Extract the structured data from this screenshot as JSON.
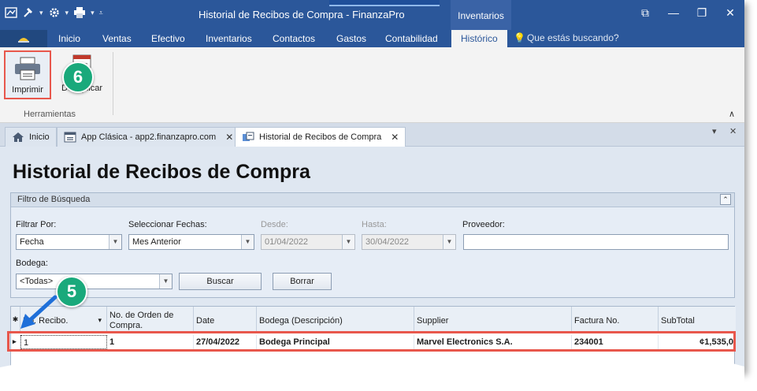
{
  "window": {
    "title": "Historial de Recibos de Compra - FinanzaPro",
    "context_tab": "Inventarios",
    "controls": {
      "restore": "⧉",
      "minimize": "—",
      "maximize": "❐",
      "close": "✕"
    }
  },
  "quick_access": {
    "icons": [
      "app-icon",
      "hammer-icon",
      "gear-icon",
      "printer-icon"
    ],
    "dropdown": "▾",
    "customize": "⩡"
  },
  "ribbon_tabs": {
    "file_icon": "app-menu-icon",
    "items": [
      "Inicio",
      "Ventas",
      "Efectivo",
      "Inventarios",
      "Contactos",
      "Gastos",
      "Contabilidad",
      "Histórico"
    ],
    "active": "Histórico",
    "search_placeholder": "Que estás buscando?"
  },
  "ribbon": {
    "print_label": "Imprimir",
    "unprint_label": "Desaplicar",
    "group_label": "Herramientas",
    "collapse": "∧"
  },
  "annotations": {
    "step_6": "6",
    "step_5": "5"
  },
  "doc_tabs": {
    "items": [
      {
        "label": "Inicio",
        "icon": "home-icon",
        "closable": false
      },
      {
        "label": "App Clásica - app2.finanzapro.com",
        "icon": "window-icon",
        "closable": true
      },
      {
        "label": "Historial de Recibos de Compra",
        "icon": "receipt-icon",
        "closable": true
      }
    ],
    "active_index": 2,
    "close_glyph": "✕",
    "menu_glyph": "▾"
  },
  "page": {
    "title": "Historial de Recibos de Compra"
  },
  "filter": {
    "title": "Filtro de Búsqueda",
    "collapse_glyph": "⌃",
    "filtrar_por": {
      "label": "Filtrar Por:",
      "value": "Fecha"
    },
    "seleccionar_fechas": {
      "label": "Seleccionar Fechas:",
      "value": "Mes Anterior"
    },
    "desde": {
      "label": "Desde:",
      "value": "01/04/2022"
    },
    "hasta": {
      "label": "Hasta:",
      "value": "30/04/2022"
    },
    "proveedor": {
      "label": "Proveedor:",
      "value": ""
    },
    "bodega": {
      "label": "Bodega:",
      "value": "<Todas>"
    },
    "buscar_label": "Buscar",
    "borrar_label": "Borrar"
  },
  "grid": {
    "columns": [
      "No. Recibo.",
      "No. de Orden de Compra.",
      "Date",
      "Bodega (Descripción)",
      "Supplier",
      "Factura No.",
      "SubTotal"
    ],
    "rows": [
      [
        "1",
        "1",
        "27/04/2022",
        "Bodega Principal",
        "Marvel Electronics S.A.",
        "234001",
        "¢1,535,0"
      ]
    ],
    "new_row_glyph": "✱",
    "row_indicator": "▸",
    "sort_glyph": "▾"
  },
  "colors": {
    "ribbon_blue": "#2b579a",
    "highlight_red": "#e8574c",
    "badge_green": "#19a97b",
    "arrow_blue": "#1e6fd9",
    "content_bg": "#dfe7f1"
  }
}
